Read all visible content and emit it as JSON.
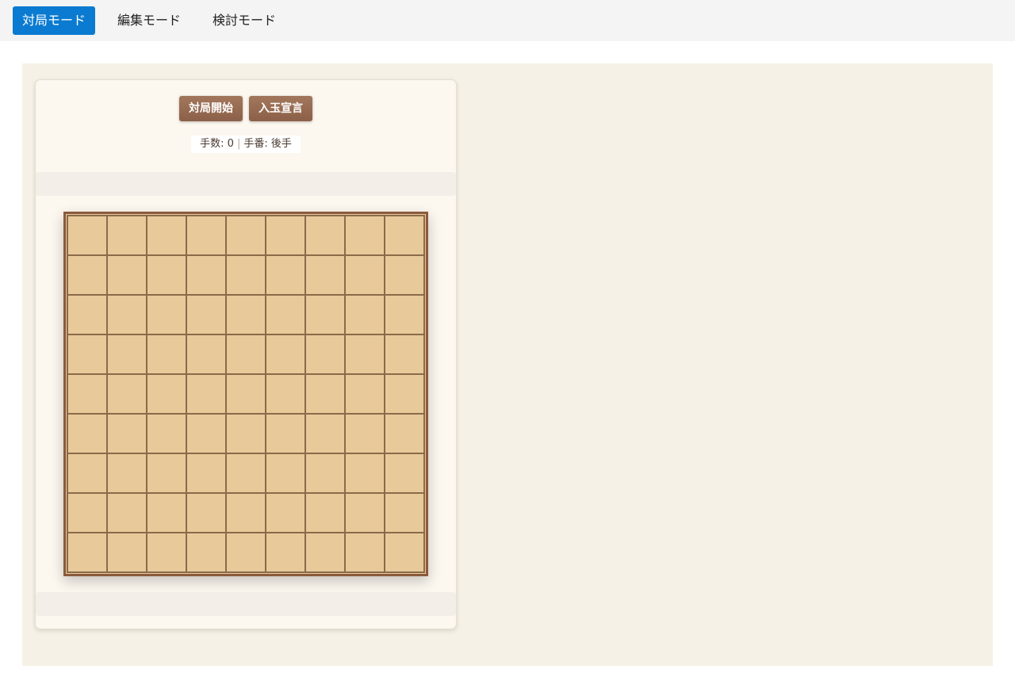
{
  "mode_tabs": [
    {
      "label": "対局モード",
      "active": true
    },
    {
      "label": "編集モード",
      "active": false
    },
    {
      "label": "検討モード",
      "active": false
    }
  ],
  "controls": {
    "start_label": "対局開始",
    "declare_label": "入玉宣言"
  },
  "status": {
    "move_count": "手数: 0",
    "separator": "|",
    "turn": "手番: 後手"
  },
  "board": {
    "files": 9,
    "ranks": 9
  },
  "colors": {
    "accent": "#0a7bd0",
    "button": "#8c6048",
    "board": "#e8c99a",
    "board_border": "#8b5a3c"
  }
}
